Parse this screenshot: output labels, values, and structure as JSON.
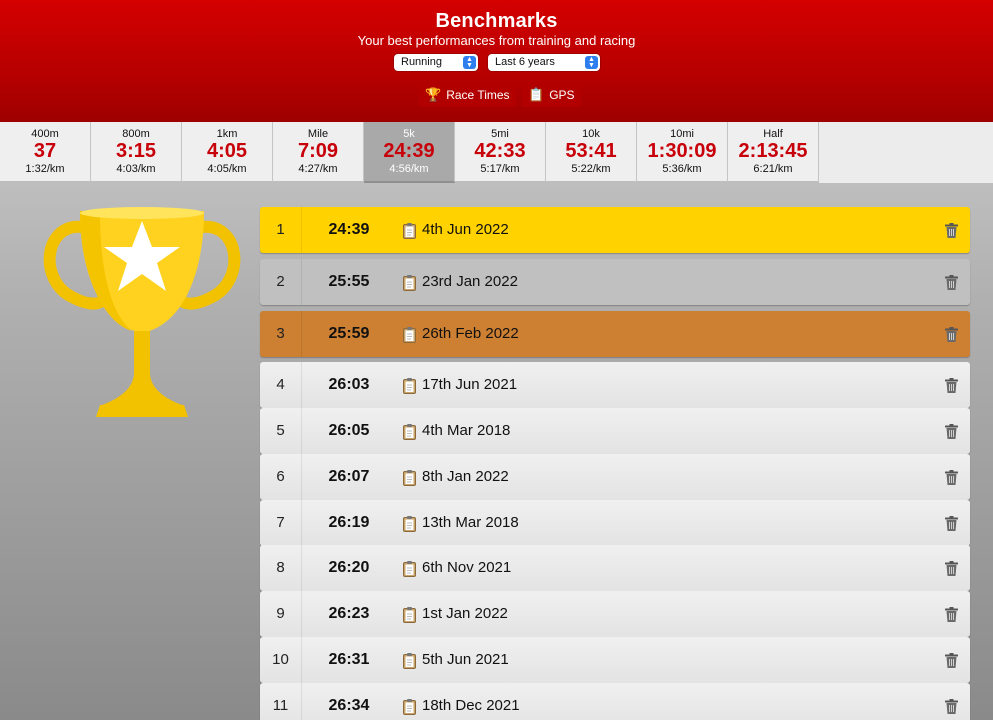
{
  "header": {
    "title": "Benchmarks",
    "subtitle": "Your best performances from training and racing",
    "sport_select": "Running",
    "period_select": "Last 6 years",
    "tabs": [
      {
        "label": "Race Times",
        "icon": "trophy-icon"
      },
      {
        "label": "GPS",
        "icon": "clipboard-icon"
      }
    ]
  },
  "distances": [
    {
      "name": "400m",
      "time": "37",
      "pace": "1:32/km"
    },
    {
      "name": "800m",
      "time": "3:15",
      "pace": "4:03/km"
    },
    {
      "name": "1km",
      "time": "4:05",
      "pace": "4:05/km"
    },
    {
      "name": "Mile",
      "time": "7:09",
      "pace": "4:27/km"
    },
    {
      "name": "5k",
      "time": "24:39",
      "pace": "4:56/km",
      "active": true
    },
    {
      "name": "5mi",
      "time": "42:33",
      "pace": "5:17/km"
    },
    {
      "name": "10k",
      "time": "53:41",
      "pace": "5:22/km"
    },
    {
      "name": "10mi",
      "time": "1:30:09",
      "pace": "5:36/km"
    },
    {
      "name": "Half",
      "time": "2:13:45",
      "pace": "6:21/km"
    }
  ],
  "results": [
    {
      "rank": "1",
      "time": "24:39",
      "date": "4th Jun 2022",
      "medal": "gold"
    },
    {
      "rank": "2",
      "time": "25:55",
      "date": "23rd Jan 2022",
      "medal": "silver"
    },
    {
      "rank": "3",
      "time": "25:59",
      "date": "26th Feb 2022",
      "medal": "bronze"
    },
    {
      "rank": "4",
      "time": "26:03",
      "date": "17th Jun 2021"
    },
    {
      "rank": "5",
      "time": "26:05",
      "date": "4th Mar 2018"
    },
    {
      "rank": "6",
      "time": "26:07",
      "date": "8th Jan 2022"
    },
    {
      "rank": "7",
      "time": "26:19",
      "date": "13th Mar 2018"
    },
    {
      "rank": "8",
      "time": "26:20",
      "date": "6th Nov 2021"
    },
    {
      "rank": "9",
      "time": "26:23",
      "date": "1st Jan 2022"
    },
    {
      "rank": "10",
      "time": "26:31",
      "date": "5th Jun 2021"
    },
    {
      "rank": "11",
      "time": "26:34",
      "date": "18th Dec 2021"
    }
  ],
  "colors": {
    "header_red": "#c00000",
    "time_red": "#c8000a",
    "gold": "#ffd200",
    "silver": "#c0c0c0",
    "bronze": "#cd7f32"
  },
  "icons": {
    "trophy": "trophy-icon",
    "row_clipboard": "clipboard-icon",
    "row_delete": "trash-icon"
  }
}
